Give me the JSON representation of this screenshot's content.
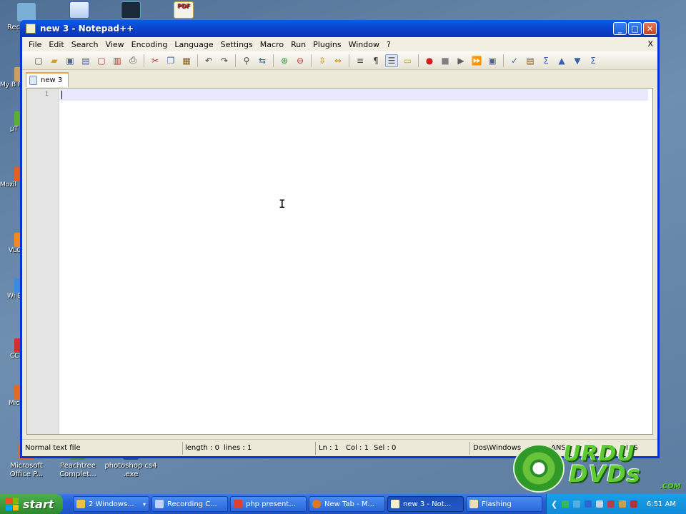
{
  "desktop": {
    "top_icons": [
      {
        "label": "Rec"
      },
      {
        "label": ""
      },
      {
        "label": ""
      },
      {
        "label": ""
      }
    ],
    "left_icons": [
      "My B P",
      "µT",
      "Mozil",
      "VLC p",
      "Wi Brov",
      "CC",
      "Mic Offi"
    ],
    "bottom_icons": [
      {
        "label1": "Microsoft",
        "label2": "Office P..."
      },
      {
        "label1": "Peachtree",
        "label2": "Complet..."
      },
      {
        "label1": "photoshop cs4",
        "label2": ".exe"
      }
    ]
  },
  "window": {
    "title": "new  3 - Notepad++",
    "buttons": {
      "minimize": "_",
      "maximize": "□",
      "close": "✕"
    }
  },
  "menu": {
    "items": [
      "File",
      "Edit",
      "Search",
      "View",
      "Encoding",
      "Language",
      "Settings",
      "Macro",
      "Run",
      "Plugins",
      "Window",
      "?"
    ],
    "close_doc": "X"
  },
  "toolbar": {
    "icons": [
      "new-icon",
      "open-icon",
      "save-icon",
      "save-all-icon",
      "close-icon",
      "close-all-icon",
      "print-icon",
      "cut-icon",
      "copy-icon",
      "paste-icon",
      "undo-icon",
      "redo-icon",
      "find-icon",
      "replace-icon",
      "zoom-in-icon",
      "zoom-out-icon",
      "sync-v-icon",
      "sync-h-icon",
      "wrap-icon",
      "all-chars-icon",
      "indent-guide-icon",
      "user-lang-icon",
      "record-icon",
      "stop-icon",
      "play-icon",
      "play-multi-icon",
      "save-macro-icon",
      "spell-check-icon",
      "spell-check2-icon",
      "summary-icon",
      "up-icon",
      "down-icon",
      "collapse-icon"
    ]
  },
  "tab": {
    "label": "new  3"
  },
  "editor": {
    "line_number": "1",
    "cursor": "I"
  },
  "status": {
    "type": "Normal text file",
    "length": "length : 0",
    "lines": "lines : 1",
    "ln": "Ln : 1",
    "col": "Col : 1",
    "sel": "Sel : 0",
    "eol": "Dos\\Windows",
    "encoding": "ANSI",
    "ins": "INS"
  },
  "watermark": {
    "line1": "URDU",
    "line2": "DVDs",
    "suffix": ".COM"
  },
  "taskbar": {
    "start": "start",
    "tasks": [
      {
        "label": "2 Windows...",
        "color": "#f0c040",
        "active": false
      },
      {
        "label": "Recording C...",
        "color": "#c0d0ff",
        "active": false
      },
      {
        "label": "php present...",
        "color": "#e04030",
        "active": false
      },
      {
        "label": "New Tab - M...",
        "color": "#e07820",
        "active": false
      },
      {
        "label": "new  3 - Not...",
        "color": "#f4f0c8",
        "active": true
      },
      {
        "label": "Flashing",
        "color": "#e8e0b0",
        "active": false
      }
    ],
    "clock": "6:51 AM"
  }
}
